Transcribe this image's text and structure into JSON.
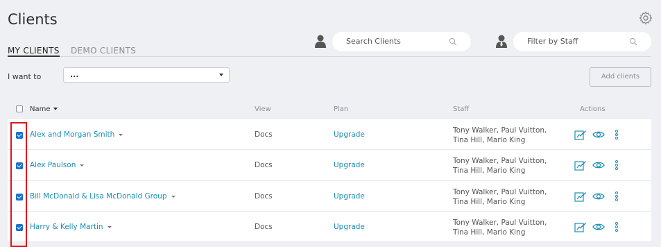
{
  "page": {
    "title": "Clients"
  },
  "tabs": [
    {
      "label": "MY CLIENTS",
      "active": true
    },
    {
      "label": "DEMO CLIENTS",
      "active": false
    }
  ],
  "search_clients": {
    "placeholder": "Search Clients"
  },
  "filter_staff": {
    "placeholder": "Filter by Staff"
  },
  "bulk": {
    "label": "I want to",
    "selected": "...",
    "add_button": "Add clients"
  },
  "columns": {
    "name": "Name",
    "view": "View",
    "plan": "Plan",
    "staff": "Staff",
    "actions": "Actions"
  },
  "rows": [
    {
      "name": "Alex and Morgan Smith",
      "view": "Docs",
      "plan": "Upgrade",
      "staff_line1": "Tony Walker, Paul Vuitton,",
      "staff_line2": "Tina Hill, Mario King",
      "checked": true
    },
    {
      "name": "Alex Paulson",
      "view": "Docs",
      "plan": "Upgrade",
      "staff_line1": "Tony Walker, Paul Vuitton,",
      "staff_line2": "Tina Hill, Mario King",
      "checked": true
    },
    {
      "name": "Bill McDonald & Lisa McDonald Group",
      "view": "Docs",
      "plan": "Upgrade",
      "staff_line1": "Tony Walker, Paul Vuitton,",
      "staff_line2": "Tina Hill, Mario King",
      "checked": true
    },
    {
      "name": "Harry & Kelly Martin",
      "view": "Docs",
      "plan": "Upgrade",
      "staff_line1": "Tony Walker, Paul Vuitton,",
      "staff_line2": "Tina Hill, Mario King",
      "checked": true
    }
  ],
  "icons": {
    "settings": "gear-icon",
    "client_person": "person-icon",
    "staff_person": "staff-person-icon",
    "search": "search-icon",
    "edit": "edit-icon",
    "view": "eye-icon",
    "more": "more-vertical-icon"
  },
  "colors": {
    "link": "#1a8fb3",
    "checkbox": "#1a73c8",
    "highlight": "#e01414",
    "background": "#eef0f3"
  }
}
